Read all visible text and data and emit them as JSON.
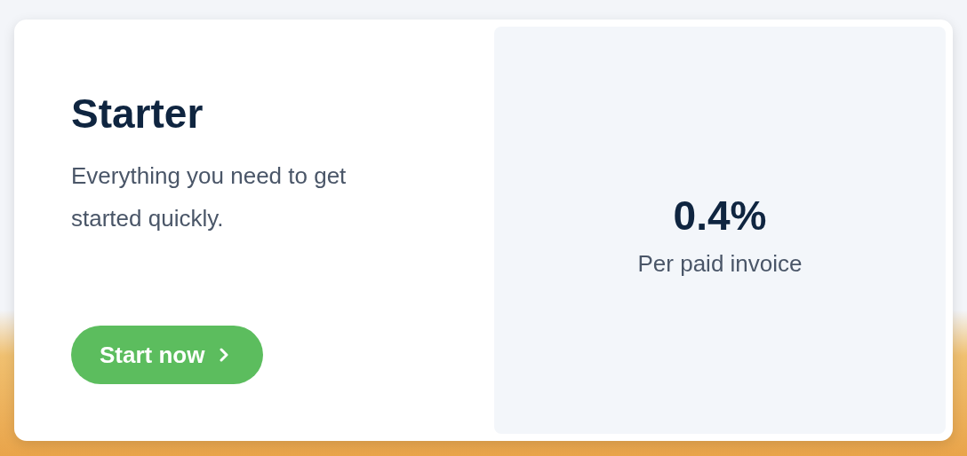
{
  "plan": {
    "title": "Starter",
    "description": "Everything you need to get started quickly.",
    "button": {
      "label": "Start now"
    }
  },
  "pricing": {
    "rate": "0.4%",
    "caption": "Per paid invoice"
  }
}
